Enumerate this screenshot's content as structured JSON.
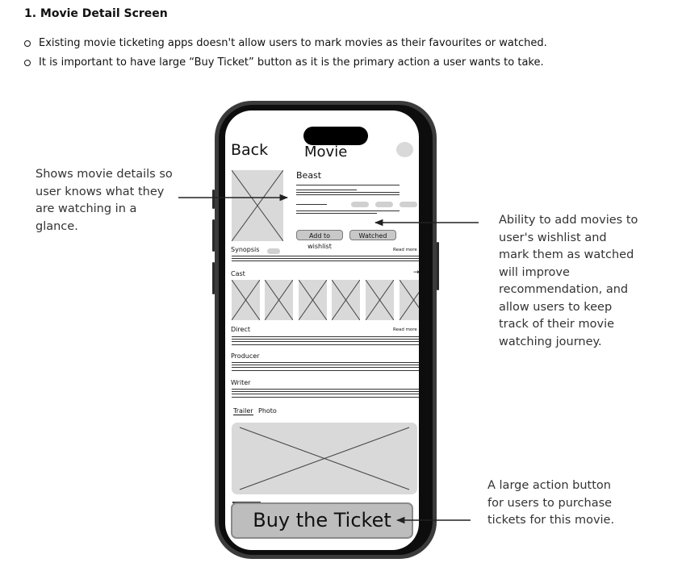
{
  "heading": "1. Movie Detail Screen",
  "bullets": [
    "Existing movie ticketing apps doesn't allow users to mark movies as their favourites or watched.",
    "It is important to have large “Buy Ticket” button as it is the primary action a user wants to take."
  ],
  "annotations": {
    "left": [
      "Shows movie details so",
      "user knows what they",
      "are watching in a",
      "glance."
    ],
    "right_top": [
      "Ability to add movies to",
      "user's wishlist and",
      "mark them as watched",
      "will improve",
      "recommendation, and",
      "allow users to keep",
      "track of their movie",
      "watching journey."
    ],
    "right_bottom": [
      "A large action button",
      "for users to purchase",
      "tickets for this movie."
    ]
  },
  "phone": {
    "back": "Back",
    "title": "Movie",
    "movie_name": "Beast",
    "wishlist_button": "Add to wishlist",
    "watched_button": "Watched",
    "synopsis_label": "Synopsis",
    "read_more_1": "Read more",
    "cast_label": "Cast",
    "cast_arrow": "→",
    "direct_label": "Direct",
    "read_more_2": "Read more",
    "producer_label": "Producer",
    "writer_label": "Writer",
    "tab_trailer": "Trailer",
    "tab_photo": "Photo",
    "buy_button": "Buy the Ticket"
  }
}
